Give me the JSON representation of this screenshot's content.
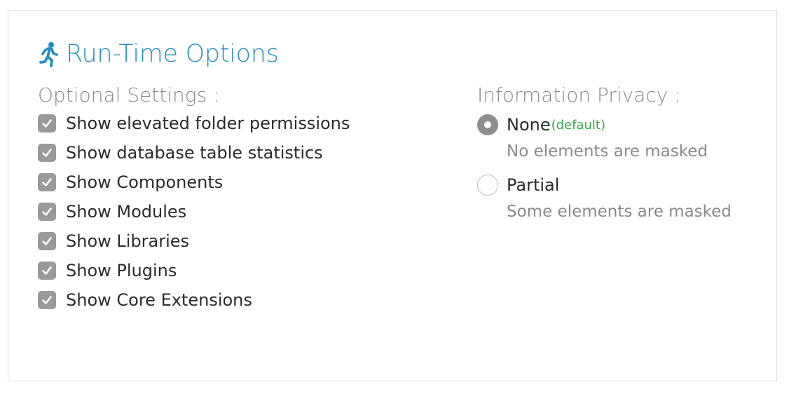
{
  "title": "Run-Time Options",
  "colors": {
    "accent": "#2a8dbd",
    "default_green": "#3aa64a"
  },
  "optional_settings": {
    "label": "Optional Settings :",
    "items": [
      {
        "label": "Show elevated folder permissions",
        "checked": true
      },
      {
        "label": "Show database table statistics",
        "checked": true
      },
      {
        "label": "Show Components",
        "checked": true
      },
      {
        "label": "Show Modules",
        "checked": true
      },
      {
        "label": "Show Libraries",
        "checked": true
      },
      {
        "label": "Show Plugins",
        "checked": true
      },
      {
        "label": "Show Core Extensions",
        "checked": true
      }
    ]
  },
  "privacy": {
    "label": "Information Privacy :",
    "options": [
      {
        "label": "None",
        "tag": "(default)",
        "description": "No elements are masked",
        "selected": true
      },
      {
        "label": "Partial",
        "tag": "",
        "description": "Some elements are masked",
        "selected": false
      }
    ]
  },
  "icons": {
    "title_icon": "running-person-icon",
    "checkbox_icon": "checkmark-icon"
  }
}
